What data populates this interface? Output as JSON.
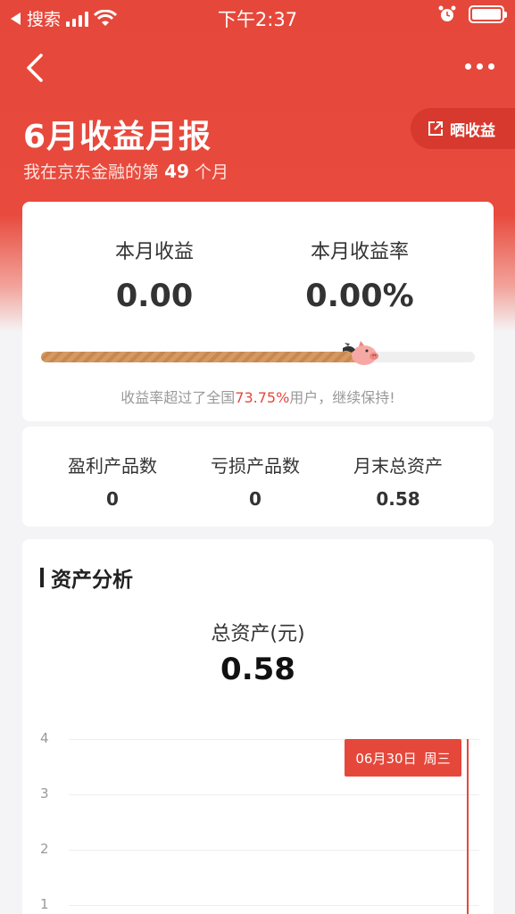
{
  "status_bar": {
    "back_app": "搜索",
    "time": "下午2:37"
  },
  "header": {
    "title": "6月收益月报",
    "subtitle_prefix": "我在京东金融的第",
    "subtitle_number": "49",
    "subtitle_suffix": "个月",
    "share_label": "晒收益"
  },
  "summary": {
    "income_label": "本月收益",
    "income_value": "0.00",
    "rate_label": "本月收益率",
    "rate_value": "0.00%",
    "beat_percent": 73.75,
    "beat_prefix": "收益率超过了全国",
    "beat_value": "73.75%",
    "beat_suffix": "用户，继续保持!"
  },
  "stats": {
    "profit_label": "盈利产品数",
    "profit_value": "0",
    "loss_label": "亏损产品数",
    "loss_value": "0",
    "assets_label": "月末总资产",
    "assets_value": "0.58"
  },
  "analysis": {
    "section_title": "资产分析",
    "total_label": "总资产(元)",
    "total_value": "0.58"
  },
  "chart_data": {
    "type": "line",
    "y_ticks": [
      "4",
      "3",
      "2",
      "1"
    ],
    "ylim": [
      0,
      4
    ],
    "tooltip_date": "06月30日",
    "tooltip_weekday": "周三"
  },
  "colors": {
    "brand_red": "#e5483b",
    "progress_gold": "#d49a63"
  },
  "icons": {
    "back": "chevron-left-icon",
    "more": "more-dots-icon",
    "share": "share-icon",
    "pig": "piggy-mascot-icon"
  }
}
